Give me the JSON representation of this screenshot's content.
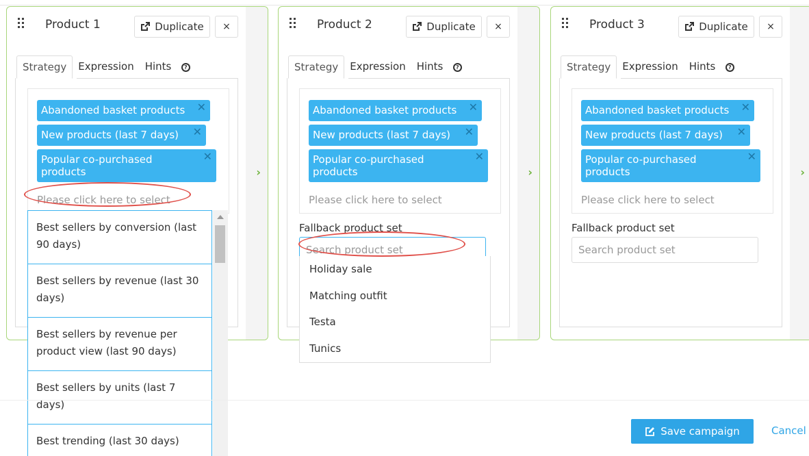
{
  "cards": [
    {
      "title": "Product 1",
      "duplicate_label": "Duplicate",
      "close_label": "×",
      "tabs": [
        "Strategy",
        "Expression",
        "Hints"
      ],
      "chips": [
        "Abandoned basket products",
        "New products (last 7 days)",
        "Popular co-purchased products"
      ],
      "select_placeholder": "Please click here to select",
      "strategy_options": [
        "Best sellers by conversion (last 90 days)",
        "Best sellers by revenue (last 30 days)",
        "Best sellers by revenue per product view (last 90 days)",
        "Best sellers by units (last 7 days)",
        "Best trending (last 30 days)"
      ]
    },
    {
      "title": "Product 2",
      "duplicate_label": "Duplicate",
      "close_label": "×",
      "tabs": [
        "Strategy",
        "Expression",
        "Hints"
      ],
      "chips": [
        "Abandoned basket products",
        "New products (last 7 days)",
        "Popular co-purchased products"
      ],
      "select_placeholder": "Please click here to select",
      "fallback_label": "Fallback product set",
      "fallback_placeholder": "Search product set",
      "fallback_options": [
        "Holiday sale",
        "Matching outfit",
        "Testa",
        "Tunics"
      ]
    },
    {
      "title": "Product 3",
      "duplicate_label": "Duplicate",
      "close_label": "×",
      "tabs": [
        "Strategy",
        "Expression",
        "Hints"
      ],
      "chips": [
        "Abandoned basket products",
        "New products (last 7 days)",
        "Popular co-purchased products"
      ],
      "select_placeholder": "Please click here to select",
      "fallback_label": "Fallback product set",
      "fallback_placeholder": "Search product set"
    }
  ],
  "chip_remove_glyph": "✕",
  "next_glyph": "›",
  "footer": {
    "save_label": "Save campaign",
    "cancel_label": "Cancel"
  },
  "colors": {
    "chip": "#3cb4f0",
    "card_border": "#a8d67a",
    "primary": "#2fa5e6",
    "annotation": "#e0504a"
  }
}
